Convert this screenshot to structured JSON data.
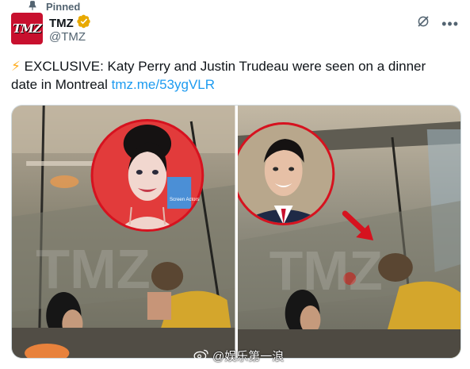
{
  "pinned": {
    "label": "Pinned"
  },
  "author": {
    "avatar_text": "TMZ",
    "name": "TMZ",
    "handle": "@TMZ",
    "verified_color": "#e8a900",
    "brand_color": "#c8102e"
  },
  "tweet": {
    "emoji": "⚡",
    "text": "EXCLUSIVE: Katy Perry and Justin Trudeau were seen on a dinner date in Montreal",
    "link": "tmz.me/53ygVLR"
  },
  "media": {
    "left": {
      "circle_caption": "Screen Actors"
    },
    "watermark_letters": "TMZ"
  },
  "watermark": {
    "text": "@娱乐第一浪"
  },
  "icons": {
    "pin": "pin-icon",
    "verified": "verified-badge-icon",
    "grok": "grok-icon",
    "more": "more-icon",
    "arrow": "red-arrow-icon"
  },
  "colors": {
    "link": "#1d9bf0",
    "muted": "#536471",
    "highlight_circle": "#d6121f"
  }
}
